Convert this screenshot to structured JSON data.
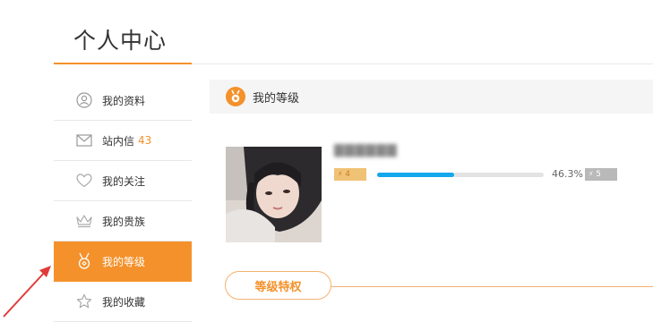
{
  "page": {
    "title": "个人中心"
  },
  "sidebar": {
    "items": [
      {
        "label": "我的资料",
        "icon": "user-circle-icon"
      },
      {
        "label": "站内信",
        "badge": "43",
        "icon": "envelope-icon"
      },
      {
        "label": "我的关注",
        "icon": "heart-icon"
      },
      {
        "label": "我的贵族",
        "icon": "crown-icon"
      },
      {
        "label": "我的等级",
        "icon": "medal-icon",
        "active": true
      },
      {
        "label": "我的收藏",
        "icon": "star-icon"
      }
    ]
  },
  "section": {
    "title": "我的等级",
    "icon": "medal-icon"
  },
  "level": {
    "current": "4",
    "next": "5",
    "progress_percent": 46.3,
    "progress_text": "46.3%"
  },
  "tabs": {
    "privileges_label": "等级特权"
  },
  "colors": {
    "accent": "#f4912b",
    "progress": "#13a7ec",
    "annotation": "#e23a3a"
  }
}
